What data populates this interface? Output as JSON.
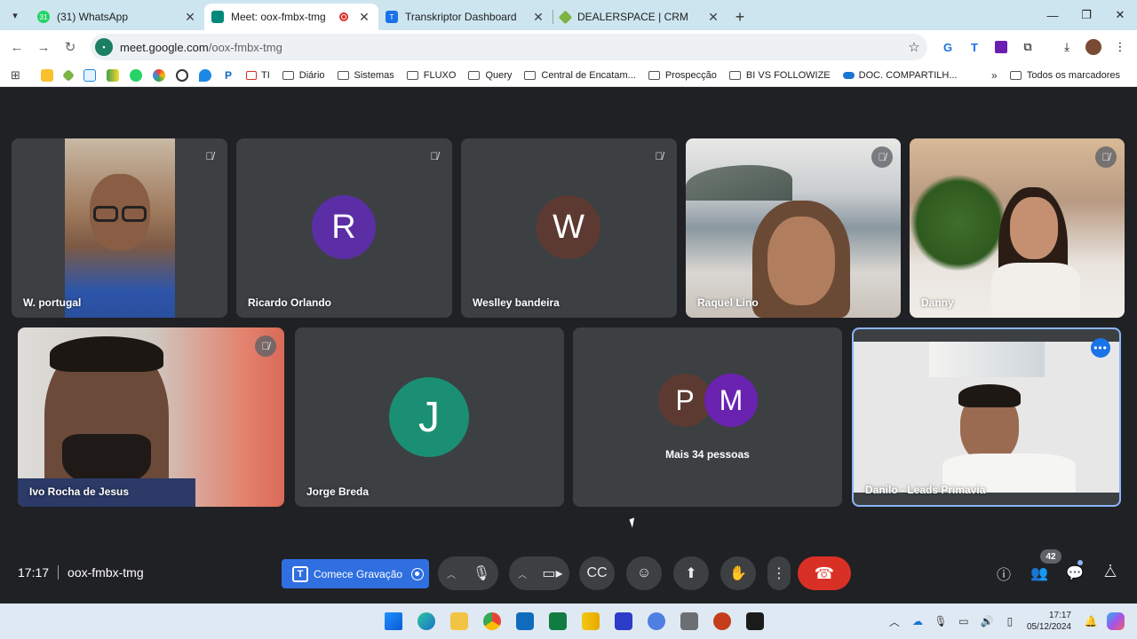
{
  "browser": {
    "tabs": [
      {
        "title": "(31) WhatsApp",
        "favicon_color": "#25d366",
        "favicon_glyph": "31",
        "active": false
      },
      {
        "title": "Meet: oox-fmbx-tmg",
        "favicon_color": "#00897b",
        "favicon_glyph": "",
        "active": true
      },
      {
        "title": "Transkriptor Dashboard",
        "favicon_color": "#1a73e8",
        "favicon_glyph": "T",
        "active": false
      },
      {
        "title": "DEALERSPACE | CRM",
        "favicon_color": "#7cb342",
        "favicon_glyph": "",
        "active": false
      }
    ],
    "url_host": "meet.google.com",
    "url_path": "/oox-fmbx-tmg"
  },
  "bookmarks": {
    "items": [
      "TI",
      "Diário",
      "Sistemas",
      "FLUXO",
      "Query",
      "Central de Encatam...",
      "Prospecção",
      "BI VS FOLLOWIZE",
      "DOC. COMPARTILH..."
    ],
    "all_bookmarks": "Todos os marcadores"
  },
  "meet": {
    "participants": [
      {
        "name": "W. portugal",
        "type": "video",
        "muted": true
      },
      {
        "name": "Ricardo Orlando",
        "type": "avatar",
        "initial": "R",
        "color": "#5b2ea6",
        "muted": true
      },
      {
        "name": "Weslley bandeira",
        "type": "avatar",
        "initial": "W",
        "color": "#5d3a31",
        "muted": true
      },
      {
        "name": "Raquel Lino",
        "type": "video",
        "muted": true
      },
      {
        "name": "Danny",
        "type": "video",
        "muted": true
      },
      {
        "name": "Ivo Rocha de Jesus",
        "type": "video",
        "muted": true
      },
      {
        "name": "Jorge Breda",
        "type": "avatar",
        "initial": "J",
        "color": "#1b8f74",
        "muted": false
      },
      {
        "name": "Danilo - Leads Primavia",
        "type": "video",
        "muted": false,
        "active_speaker": true
      }
    ],
    "others": {
      "initials": [
        "P",
        "M"
      ],
      "colors": [
        "#5d3a31",
        "#6a22b0"
      ],
      "label": "Mais 34 pessoas"
    },
    "time": "17:17",
    "meeting_code": "oox-fmbx-tmg",
    "record_label": "Comece Gravação",
    "participant_count": "42"
  },
  "taskbar": {
    "time": "17:17",
    "date": "05/12/2024"
  }
}
